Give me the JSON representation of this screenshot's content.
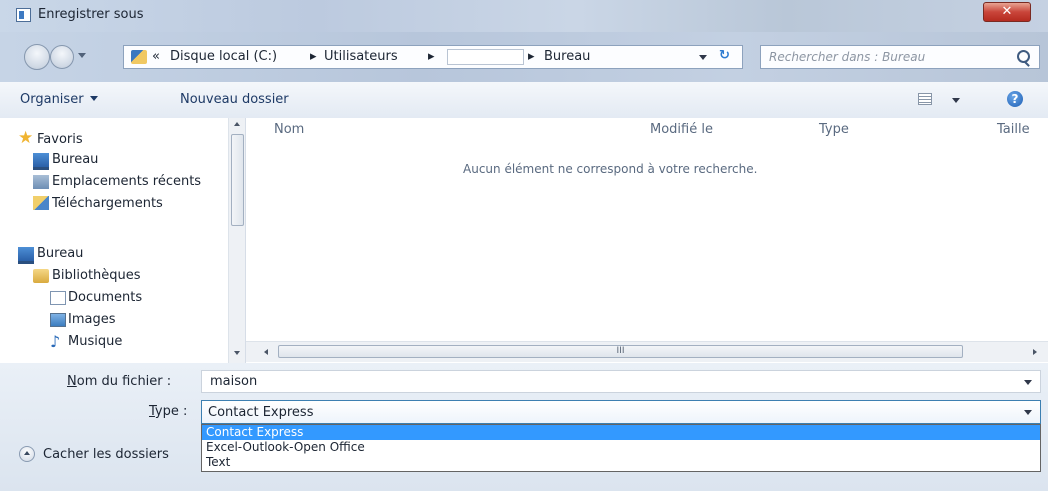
{
  "window": {
    "title": "Enregistrer sous",
    "close_glyph": "✕"
  },
  "address": {
    "overflow": "«",
    "crumbs": [
      "Disque local (C:)",
      "Utilisateurs",
      "Bureau"
    ],
    "separator": "▸",
    "refresh_glyph": "↻"
  },
  "search": {
    "placeholder": "Rechercher dans : Bureau"
  },
  "toolbar": {
    "organize_label": "Organiser",
    "new_folder_label": "Nouveau dossier",
    "help_glyph": "?"
  },
  "sidebar": {
    "favorites_label": "Favoris",
    "favorites": [
      "Bureau",
      "Emplacements récents",
      "Téléchargements"
    ],
    "desktop_label": "Bureau",
    "libraries_label": "Bibliothèques",
    "libraries": [
      "Documents",
      "Images",
      "Musique"
    ]
  },
  "columns": {
    "name": "Nom",
    "modified": "Modifié le",
    "type": "Type",
    "size": "Taille"
  },
  "content": {
    "empty_message": "Aucun élément ne correspond à votre recherche."
  },
  "hscroll": {
    "grip": "III"
  },
  "form": {
    "filename_label_key": "N",
    "filename_label_rest": "om du fichier :",
    "filename_value": "maison",
    "type_label_key": "T",
    "type_label_rest": "ype :",
    "type_value": "Contact Express",
    "type_options": [
      "Contact Express",
      "Excel-Outlook-Open Office",
      "Text"
    ],
    "type_selected_index": 0,
    "hide_folders_label": "Cacher les dossiers"
  }
}
